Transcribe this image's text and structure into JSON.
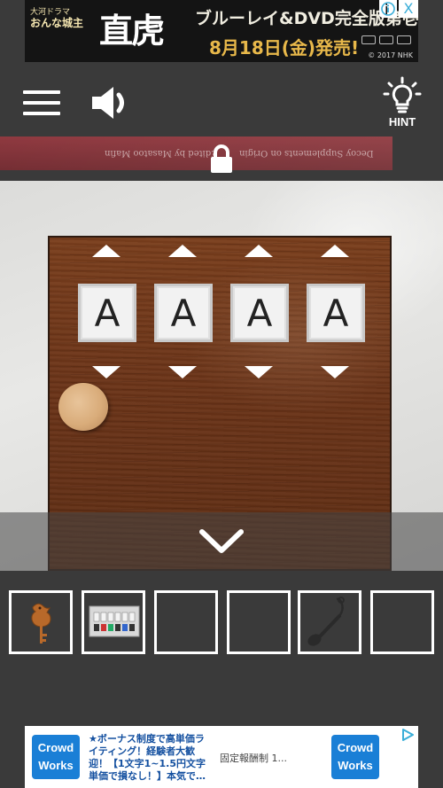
{
  "top_ad": {
    "small_title_1": "大河ドラマ",
    "small_title_2": "おんな城主",
    "logo": "直虎",
    "headline": "ブルーレイ&DVD完全版第壱集",
    "release": "8月18日(金)発売!",
    "copyright": "© 2017 NHK",
    "info_icon": "info-icon",
    "close_label": "X"
  },
  "toolbar": {
    "menu_icon": "menu-icon",
    "sound_icon": "speaker-icon",
    "hint_icon": "lightbulb-icon",
    "hint_label": "HINT"
  },
  "room_strip": {
    "text_1": "Edited by Masatoo Mafin",
    "text_2": "Decoy Supplements on Origin",
    "lock_icon": "lock-icon"
  },
  "puzzle": {
    "tiles": [
      "A",
      "A",
      "A",
      "A"
    ],
    "up_arrow_icon": "triangle-up-icon",
    "down_arrow_icon": "triangle-down-icon",
    "knob_icon": "knob-icon"
  },
  "navigation": {
    "back_icon": "chevron-down-icon"
  },
  "inventory": {
    "slots": [
      {
        "item": "bird-key-icon"
      },
      {
        "item": "color-panel-icon"
      },
      {
        "item": ""
      },
      {
        "item": ""
      },
      {
        "item": "spoon-icon"
      },
      {
        "item": ""
      }
    ]
  },
  "bottom_ad": {
    "logo_left": "Crowd Works",
    "text": "★ボーナス制度で高単価ライティング！経験者大歓迎！【1文字1~1.5円文字単価で損なし！】本気で…",
    "middle": "固定報酬制 1...",
    "logo_right": "Crowd Works",
    "adchoice_icon": "adchoices-icon"
  },
  "colors": {
    "background": "#3a3a3a",
    "wood": "#6b3418",
    "crowdworks_blue": "#1a7fd6"
  }
}
